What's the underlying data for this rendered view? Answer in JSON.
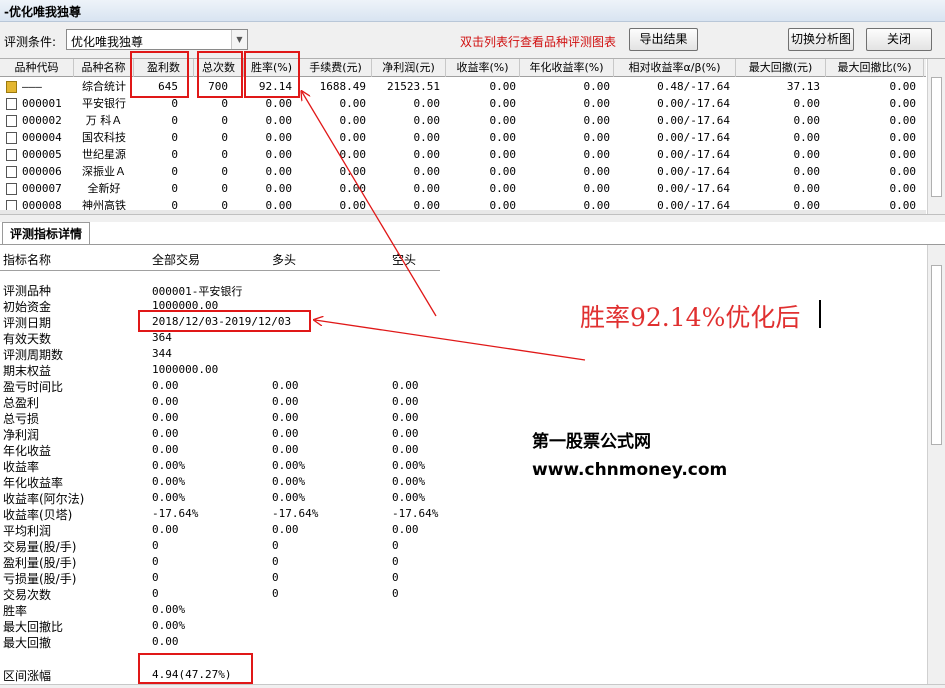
{
  "window": {
    "title": "-优化唯我独尊"
  },
  "toolbar": {
    "condition_label": "评测条件:",
    "condition_value": "优化唯我独尊",
    "hint": "双击列表行查看品种评测图表",
    "export_label": "导出结果",
    "switch_label": "切换分析图",
    "close_label": "关闭"
  },
  "grid": {
    "columns": [
      "品种代码",
      "品种名称",
      "盈利数",
      "总次数",
      "胜率(%)",
      "手续费(元)",
      "净利润(元)",
      "收益率(%)",
      "年化收益率(%)",
      "相对收益率α/β(%)",
      "最大回撤(元)",
      "最大回撤比(%)"
    ],
    "rows": [
      {
        "code": "———",
        "name": "综合统计",
        "win": "645",
        "total": "700",
        "rate": "92.14",
        "fee": "1688.49",
        "profit": "21523.51",
        "ret": "0.00",
        "annual": "0.00",
        "alpha": "0.48/-17.64",
        "dd": "37.13",
        "ddr": "0.00"
      },
      {
        "code": "000001",
        "name": "平安银行",
        "win": "0",
        "total": "0",
        "rate": "0.00",
        "fee": "0.00",
        "profit": "0.00",
        "ret": "0.00",
        "annual": "0.00",
        "alpha": "0.00/-17.64",
        "dd": "0.00",
        "ddr": "0.00"
      },
      {
        "code": "000002",
        "name": "万 科Ａ",
        "win": "0",
        "total": "0",
        "rate": "0.00",
        "fee": "0.00",
        "profit": "0.00",
        "ret": "0.00",
        "annual": "0.00",
        "alpha": "0.00/-17.64",
        "dd": "0.00",
        "ddr": "0.00"
      },
      {
        "code": "000004",
        "name": "国农科技",
        "win": "0",
        "total": "0",
        "rate": "0.00",
        "fee": "0.00",
        "profit": "0.00",
        "ret": "0.00",
        "annual": "0.00",
        "alpha": "0.00/-17.64",
        "dd": "0.00",
        "ddr": "0.00"
      },
      {
        "code": "000005",
        "name": "世纪星源",
        "win": "0",
        "total": "0",
        "rate": "0.00",
        "fee": "0.00",
        "profit": "0.00",
        "ret": "0.00",
        "annual": "0.00",
        "alpha": "0.00/-17.64",
        "dd": "0.00",
        "ddr": "0.00"
      },
      {
        "code": "000006",
        "name": "深振业Ａ",
        "win": "0",
        "total": "0",
        "rate": "0.00",
        "fee": "0.00",
        "profit": "0.00",
        "ret": "0.00",
        "annual": "0.00",
        "alpha": "0.00/-17.64",
        "dd": "0.00",
        "ddr": "0.00"
      },
      {
        "code": "000007",
        "name": "全新好",
        "win": "0",
        "total": "0",
        "rate": "0.00",
        "fee": "0.00",
        "profit": "0.00",
        "ret": "0.00",
        "annual": "0.00",
        "alpha": "0.00/-17.64",
        "dd": "0.00",
        "ddr": "0.00"
      },
      {
        "code": "000008",
        "name": "神州高铁",
        "win": "0",
        "total": "0",
        "rate": "0.00",
        "fee": "0.00",
        "profit": "0.00",
        "ret": "0.00",
        "annual": "0.00",
        "alpha": "0.00/-17.64",
        "dd": "0.00",
        "ddr": "0.00"
      }
    ]
  },
  "detail": {
    "tab_label": "评测指标详情",
    "headers": [
      "指标名称",
      "全部交易",
      "多头",
      "空头"
    ],
    "rows": [
      {
        "label": "评测品种",
        "all": "000001-平安银行",
        "long": "",
        "short": ""
      },
      {
        "label": "初始资金",
        "all": "1000000.00",
        "long": "",
        "short": ""
      },
      {
        "label": "评测日期",
        "all": "2018/12/03-2019/12/03",
        "long": "",
        "short": ""
      },
      {
        "label": "有效天数",
        "all": "364",
        "long": "",
        "short": ""
      },
      {
        "label": "评测周期数",
        "all": "344",
        "long": "",
        "short": ""
      },
      {
        "label": "期末权益",
        "all": "1000000.00",
        "long": "",
        "short": ""
      },
      {
        "label": "盈亏时间比",
        "all": "0.00",
        "long": "0.00",
        "short": "0.00"
      },
      {
        "label": "总盈利",
        "all": "0.00",
        "long": "0.00",
        "short": "0.00"
      },
      {
        "label": "总亏损",
        "all": "0.00",
        "long": "0.00",
        "short": "0.00"
      },
      {
        "label": "净利润",
        "all": "0.00",
        "long": "0.00",
        "short": "0.00"
      },
      {
        "label": "年化收益",
        "all": "0.00",
        "long": "0.00",
        "short": "0.00"
      },
      {
        "label": "收益率",
        "all": "0.00%",
        "long": "0.00%",
        "short": "0.00%"
      },
      {
        "label": "年化收益率",
        "all": "0.00%",
        "long": "0.00%",
        "short": "0.00%"
      },
      {
        "label": "收益率(阿尔法)",
        "all": "0.00%",
        "long": "0.00%",
        "short": "0.00%"
      },
      {
        "label": "收益率(贝塔)",
        "all": "-17.64%",
        "long": "-17.64%",
        "short": "-17.64%"
      },
      {
        "label": "平均利润",
        "all": "0.00",
        "long": "0.00",
        "short": "0.00"
      },
      {
        "label": "交易量(股/手)",
        "all": "0",
        "long": "0",
        "short": "0"
      },
      {
        "label": "盈利量(股/手)",
        "all": "0",
        "long": "0",
        "short": "0"
      },
      {
        "label": "亏损量(股/手)",
        "all": "0",
        "long": "0",
        "short": "0"
      },
      {
        "label": "交易次数",
        "all": "0",
        "long": "0",
        "short": "0"
      },
      {
        "label": "胜率",
        "all": "0.00%",
        "long": "",
        "short": ""
      },
      {
        "label": "最大回撤比",
        "all": "0.00%",
        "long": "",
        "short": ""
      },
      {
        "label": "最大回撤",
        "all": "0.00",
        "long": "",
        "short": ""
      },
      {
        "label": "",
        "all": "",
        "long": "",
        "short": ""
      },
      {
        "label": "区间涨幅",
        "all": "4.94(47.27%)",
        "long": "",
        "short": ""
      }
    ]
  },
  "annotation": {
    "text": "胜率92.14%优化后",
    "color": "#e03030"
  },
  "watermark": {
    "line1": "第一股票公式网",
    "line2": "www.chnmoney.com"
  },
  "colors": {
    "highlight": "#e01818",
    "hint": "#d01010"
  }
}
